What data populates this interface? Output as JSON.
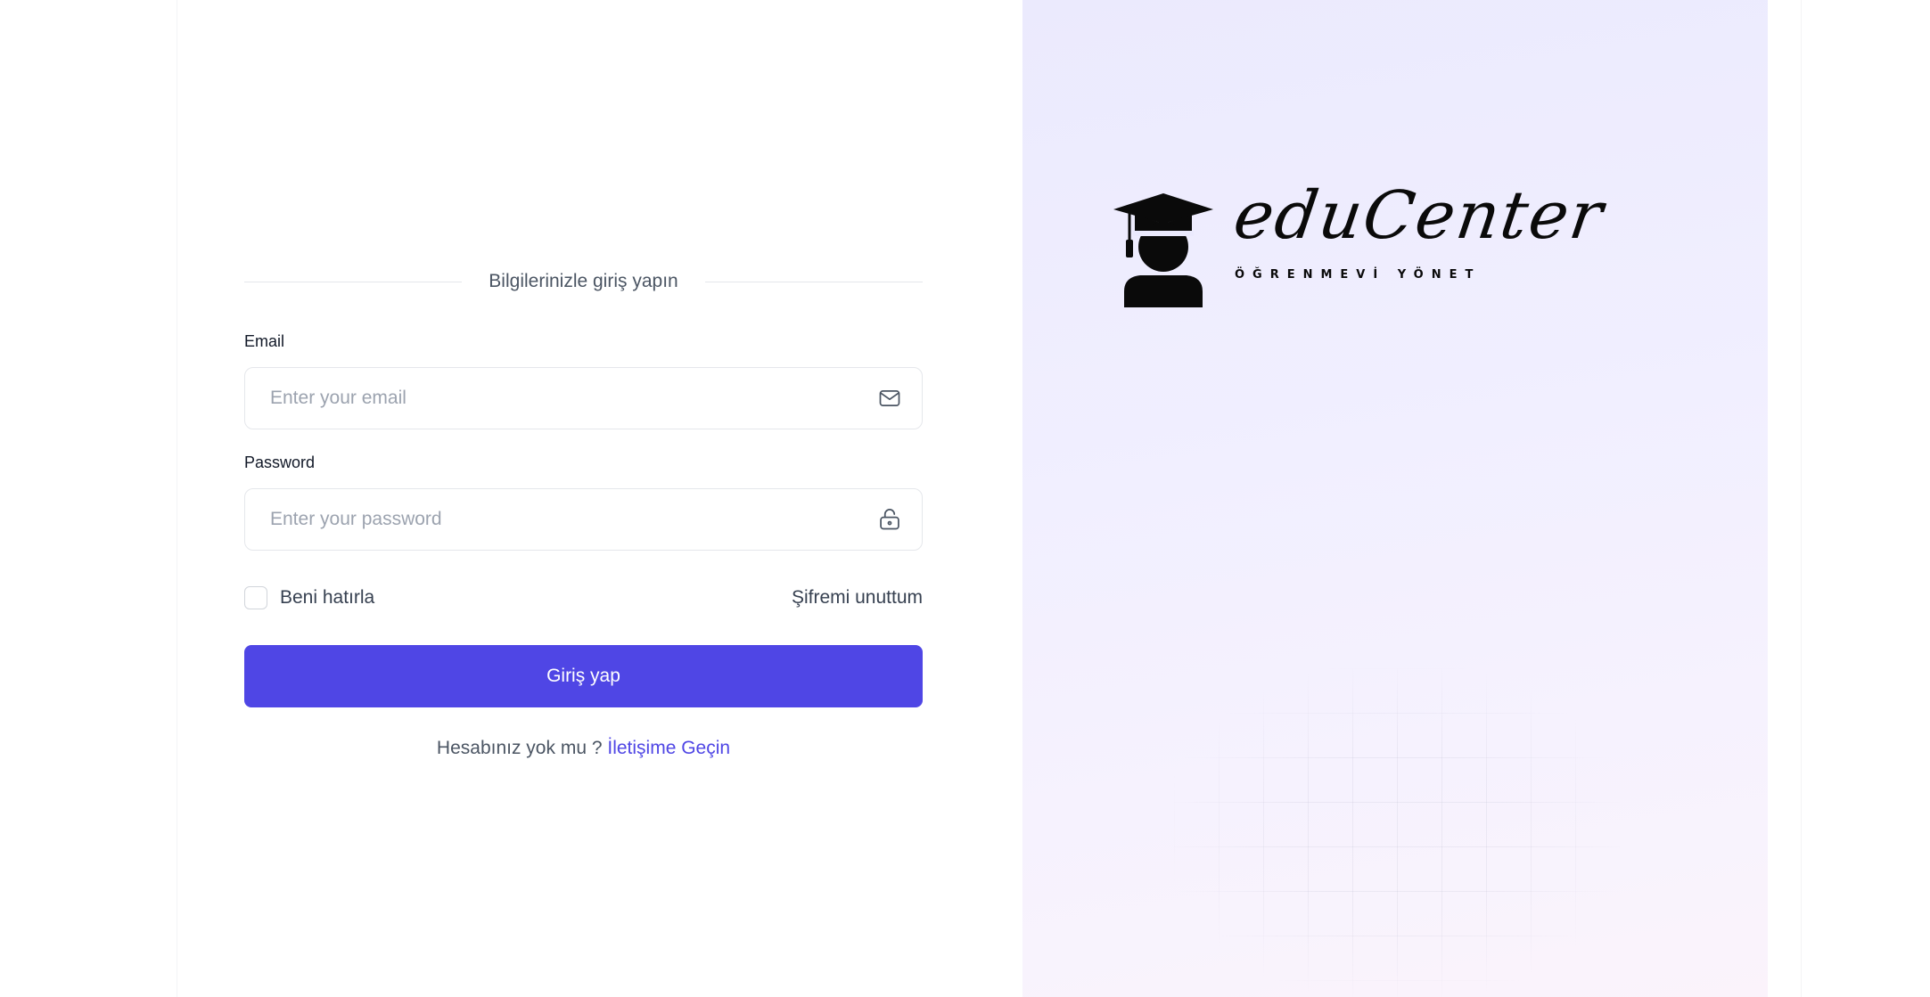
{
  "login": {
    "caption": "Bilgilerinizle giriş yapın",
    "email": {
      "label": "Email",
      "placeholder": "Enter your email",
      "icon": "mail-icon"
    },
    "password": {
      "label": "Password",
      "placeholder": "Enter your password",
      "icon": "lock-icon"
    },
    "remember_label": "Beni hatırla",
    "forgot_label": "Şifremi unuttum",
    "submit_label": "Giriş yap",
    "signup_prompt": "Hesabınız yok mu ?",
    "signup_link": "İletişime Geçin"
  },
  "brand": {
    "wordmark": "eduCenter",
    "tagline": "ÖĞRENMEVİ YÖNET",
    "logo_icon": "graduate-icon"
  },
  "colors": {
    "primary": "#4f46e5",
    "panel_top": "#ebeafd",
    "panel_bottom": "#fbf3fb",
    "text_muted": "#4b5563"
  }
}
